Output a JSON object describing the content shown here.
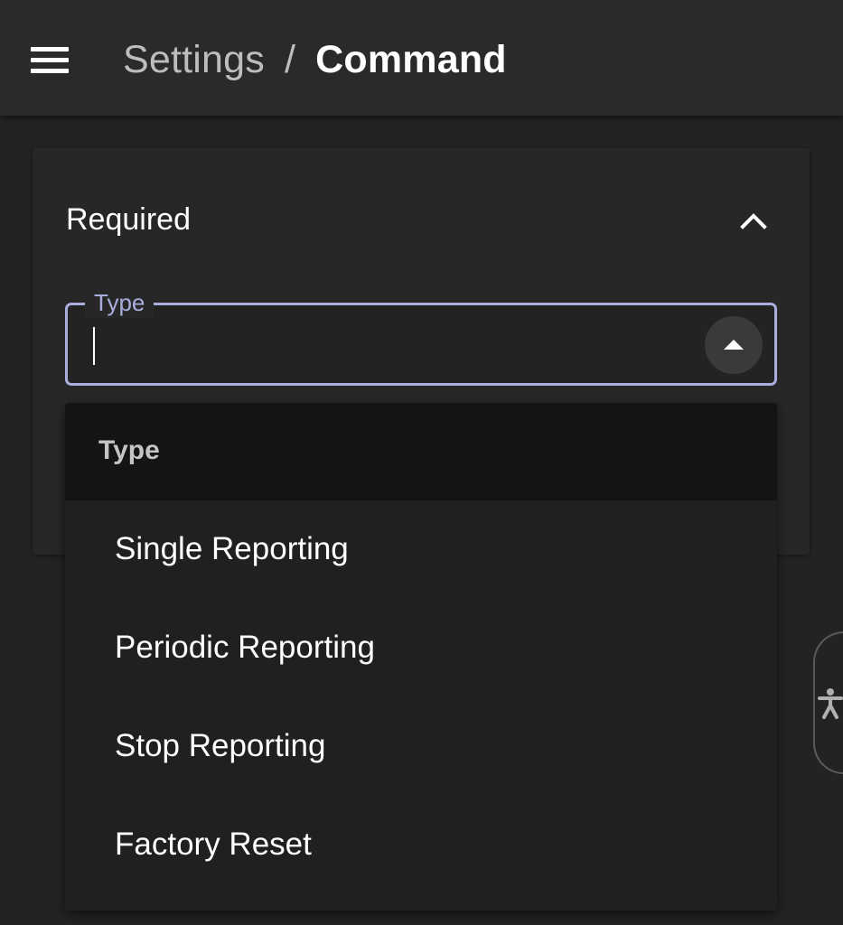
{
  "header": {
    "menu_icon": "hamburger-menu-icon",
    "breadcrumb": {
      "parent": "Settings",
      "separator": "/",
      "current": "Command"
    }
  },
  "section": {
    "title": "Required",
    "expanded": true,
    "toggle_icon": "chevron-up-icon"
  },
  "type_field": {
    "label": "Type",
    "value": "",
    "focused": true,
    "dropdown_toggle_icon": "arrow-up-icon"
  },
  "dropdown": {
    "group_label": "Type",
    "options": [
      {
        "label": "Single Reporting"
      },
      {
        "label": "Periodic Reporting"
      },
      {
        "label": "Stop Reporting"
      },
      {
        "label": "Factory Reset"
      }
    ]
  },
  "accessibility": {
    "icon": "accessibility-icon"
  },
  "colors": {
    "background": "#232323",
    "header": "#2a2a2a",
    "card": "#272727",
    "accent": "#a9aede",
    "dropdown": "#202020",
    "dropdown_group": "#141414"
  }
}
